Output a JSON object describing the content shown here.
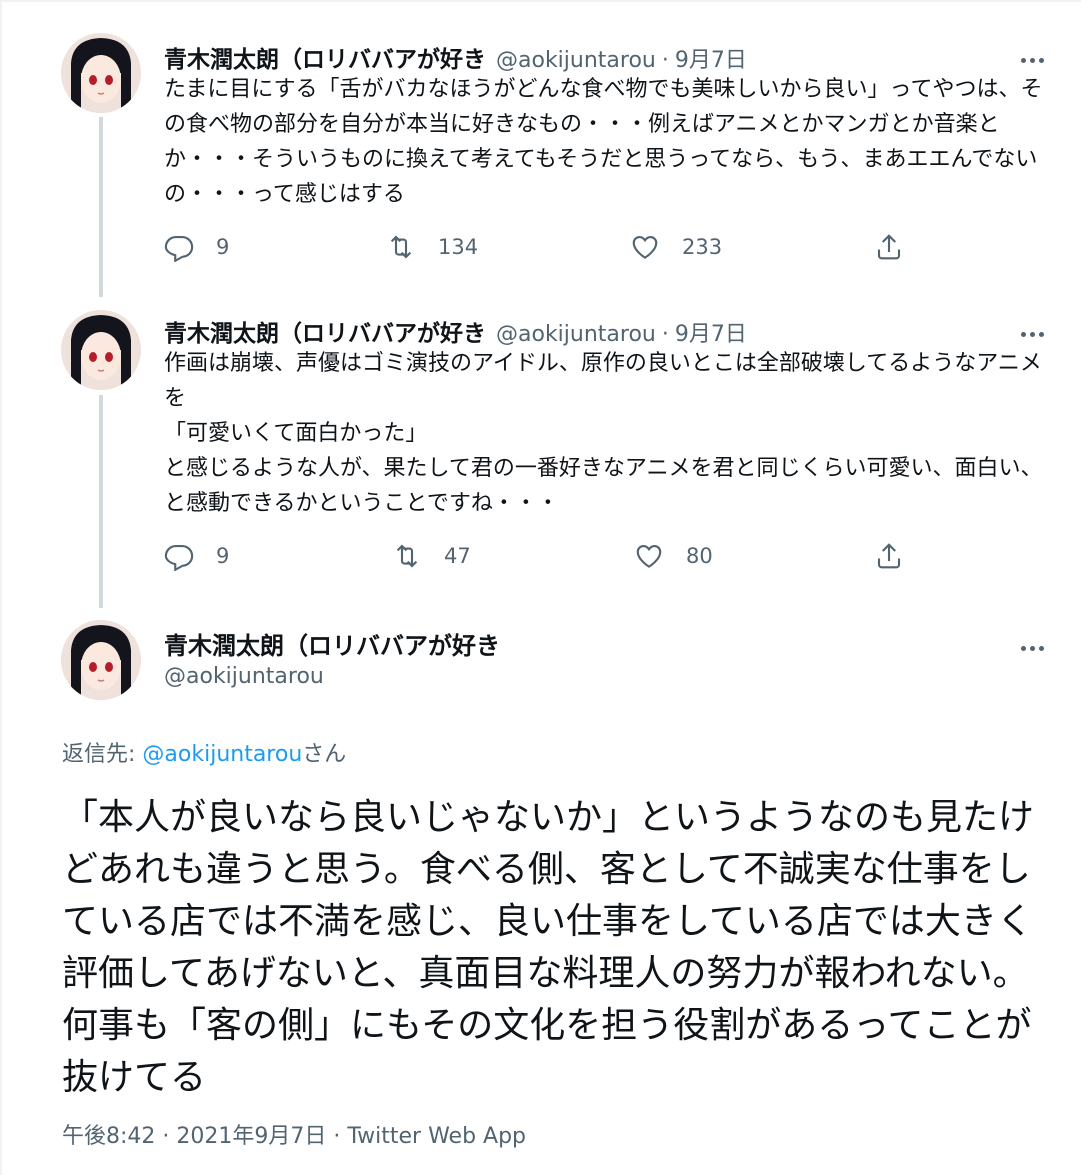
{
  "colors": {
    "link": "#1d9bf0",
    "secondary": "#536471",
    "text": "#0f1419",
    "thread_line": "#cfd9de"
  },
  "tweets": [
    {
      "name": "青木潤太朗（ロリババアが好き",
      "handle": "@aokijuntarou",
      "date": "9月7日",
      "text": "たまに目にする「舌がバカなほうがどんな食べ物でも美味しいから良い」ってやつは、その食べ物の部分を自分が本当に好きなもの・・・例えばアニメとかマンガとか音楽とか・・・そういうものに換えて考えてもそうだと思うってなら、もう、まあエエんでないの・・・って感じはする",
      "replies": "9",
      "retweets": "134",
      "likes": "233"
    },
    {
      "name": "青木潤太朗（ロリババアが好き",
      "handle": "@aokijuntarou",
      "date": "9月7日",
      "text": "作画は崩壊、声優はゴミ演技のアイドル、原作の良いとこは全部破壊してるようなアニメを\n「可愛いくて面白かった」\nと感じるような人が、果たして君の一番好きなアニメを君と同じくらい可愛い、面白い、と感動できるかということですね・・・",
      "replies": "9",
      "retweets": "47",
      "likes": "80"
    }
  ],
  "main": {
    "name": "青木潤太朗（ロリババアが好き",
    "handle": "@aokijuntarou",
    "reply_prefix": "返信先: ",
    "reply_handle": "@aokijuntarou",
    "reply_suffix": "さん",
    "text": "「本人が良いなら良いじゃないか」というようなのも見たけどあれも違うと思う。食べる側、客として不誠実な仕事をしている店では不満を感じ、良い仕事をしている店では大きく評価してあげないと、真面目な料理人の努力が報われない。何事も「客の側」にもその文化を担う役割があるってことが抜けてる",
    "timestamp": "午後8:42 · 2021年9月7日 · Twitter Web App"
  },
  "icons": [
    "reply-icon",
    "retweet-icon",
    "like-icon",
    "share-icon",
    "more-icon"
  ]
}
